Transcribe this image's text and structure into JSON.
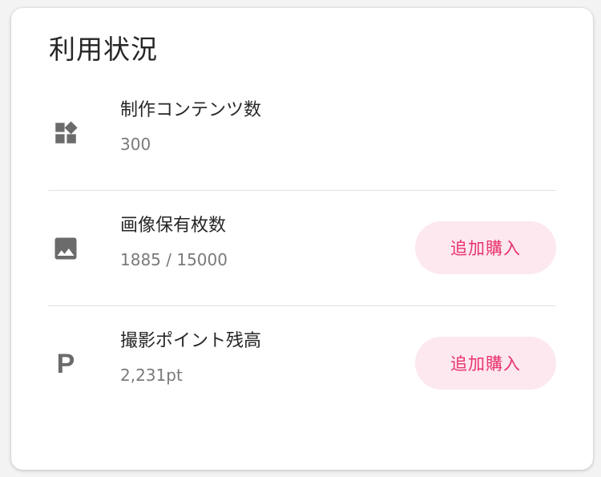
{
  "card": {
    "title": "利用状況"
  },
  "items": [
    {
      "icon": "widgets-icon",
      "label": "制作コンテンツ数",
      "value": "300"
    },
    {
      "icon": "image-icon",
      "label": "画像保有枚数",
      "value": "1885 / 15000",
      "button_label": "追加購入"
    },
    {
      "icon": "points-icon",
      "icon_glyph": "P",
      "label": "撮影ポイント残高",
      "value": "2,231pt",
      "button_label": "追加購入"
    }
  ],
  "colors": {
    "accent_text": "#e8336d",
    "accent_bg": "#fde8ef",
    "icon": "#6b6b6b",
    "label": "#262626",
    "value": "#7a7a7a"
  }
}
